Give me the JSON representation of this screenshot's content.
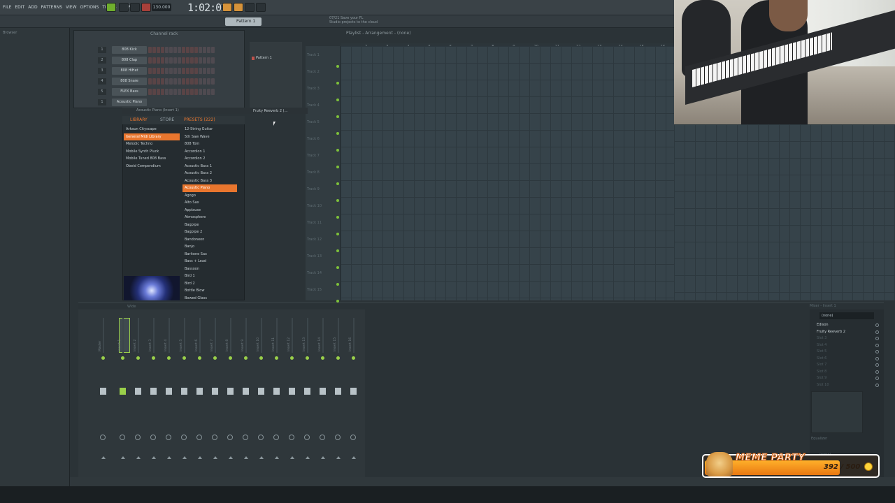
{
  "menu": [
    "FILE",
    "EDIT",
    "ADD",
    "PATTERNS",
    "VIEW",
    "OPTIONS",
    "TOOLS",
    "HELP"
  ],
  "transport": {
    "bpm": "130.000",
    "time": "1:02:02"
  },
  "pattern_selector": "Pattern 1",
  "hint": {
    "line1": "07/21  Save your FL",
    "line2": "Studio projects to the cloud"
  },
  "browser": {
    "label": "Browser"
  },
  "channel_rack": {
    "title": "Channel rack",
    "channels": [
      {
        "num": "1",
        "name": "808 Kick"
      },
      {
        "num": "2",
        "name": "808 Clap"
      },
      {
        "num": "3",
        "name": "808 HiHat"
      },
      {
        "num": "4",
        "name": "808 Snare"
      },
      {
        "num": "5",
        "name": "FLEX Bass"
      },
      {
        "num": "1",
        "name": "Acoustic Piano"
      }
    ]
  },
  "picker": {
    "pattern": "Pattern 1"
  },
  "playlist": {
    "title": "Playlist - Arrangement - (none)",
    "bars": [
      "2",
      "3",
      "4",
      "5",
      "6",
      "7",
      "8",
      "9",
      "10",
      "11",
      "12",
      "13",
      "14",
      "15",
      "16"
    ],
    "tracks": [
      "Track 1",
      "Track 2",
      "Track 3",
      "Track 4",
      "Track 5",
      "Track 6",
      "Track 7",
      "Track 8",
      "Track 9",
      "Track 10",
      "Track 11",
      "Track 12",
      "Track 13",
      "Track 14",
      "Track 15"
    ]
  },
  "plugin_bar": {
    "left": "Acoustic Piano (Insert 1)",
    "reverb": "Fruity Reeverb 2 (..."
  },
  "library": {
    "tabs": {
      "library": "LIBRARY",
      "store": "STORE",
      "presets": "PRESETS (222)"
    },
    "left_items": [
      "Arkaun Cityscape",
      "General Midi Library",
      "Melodic Techno",
      "Mobile Synth Pluck",
      "Mobile Tuned 808 Bass",
      "Obeid Compendium"
    ],
    "left_selected": 1,
    "presets": [
      "12-String Guitar",
      "5th Saw Wave",
      "808 Tom",
      "Accordion 1",
      "Accordion 2",
      "Acoustic Bass 1",
      "Acoustic Bass 2",
      "Acoustic Bass 3",
      "Acoustic Piano",
      "Agogo",
      "Alto Sax",
      "Applause",
      "Atmosphere",
      "Bagpipe",
      "Bagpipe 2",
      "Bandoneon",
      "Banjo",
      "Baritone Sax",
      "Bass + Lead",
      "Bassoon",
      "Bird 1",
      "Bird 2",
      "Bottle Blow",
      "Bowed Glass"
    ],
    "preset_selected": 8
  },
  "mixer": {
    "title": "Wide",
    "strips": [
      "Master",
      "Insert 1",
      "Insert 2",
      "Insert 3",
      "Insert 4",
      "Insert 5",
      "Insert 6",
      "Insert 7",
      "Insert 8",
      "Insert 9",
      "Insert 10",
      "Insert 11",
      "Insert 12",
      "Insert 13",
      "Insert 14",
      "Insert 15",
      "Insert 16"
    ],
    "selected_strip": 1
  },
  "insert_panel": {
    "title": "Mixer - Insert 1",
    "input": "(none)",
    "slots": [
      "Edison",
      "Fruity Reeverb 2",
      "Slot 3",
      "Slot 4",
      "Slot 5",
      "Slot 6",
      "Slot 7",
      "Slot 8",
      "Slot 9",
      "Slot 10"
    ],
    "active_slots": 2,
    "equalizer_label": "Equalizer",
    "output": "(none)"
  },
  "meme_party": {
    "title": "MEME PARTY",
    "current": 392,
    "max": 500,
    "count_text": "392 / 500"
  }
}
